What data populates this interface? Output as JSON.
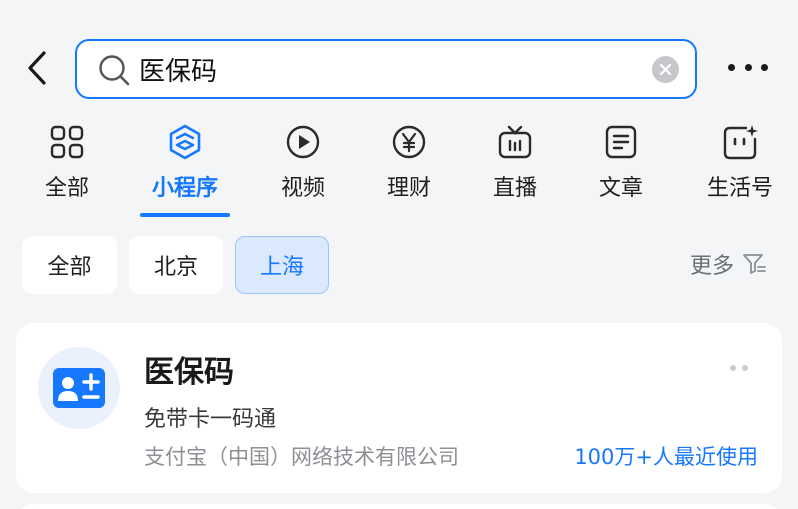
{
  "search": {
    "value": "医保码",
    "back_icon": "chevron-left-icon",
    "clear_icon": "clear-circle-icon",
    "more_icon": "more-horizontal-icon"
  },
  "tabs": [
    {
      "label": "全部",
      "icon": "grid-icon",
      "active": false
    },
    {
      "label": "小程序",
      "icon": "mini-program-icon",
      "active": true
    },
    {
      "label": "视频",
      "icon": "video-play-icon",
      "active": false
    },
    {
      "label": "理财",
      "icon": "yuan-coin-icon",
      "active": false
    },
    {
      "label": "直播",
      "icon": "tv-live-icon",
      "active": false
    },
    {
      "label": "文章",
      "icon": "article-icon",
      "active": false
    },
    {
      "label": "生活号",
      "icon": "life-account-icon",
      "active": false
    }
  ],
  "filters": {
    "chips": [
      {
        "label": "全部",
        "active": false
      },
      {
        "label": "北京",
        "active": false
      },
      {
        "label": "上海",
        "active": true
      }
    ],
    "more_label": "更多"
  },
  "result": {
    "title": "医保码",
    "desc": "免带卡一码通",
    "company": "支付宝（中国）网络技术有限公司",
    "usage": "100万+人最近使用",
    "icon": "medical-card-icon"
  },
  "colors": {
    "accent": "#1677ff",
    "active_chip_bg": "#dbe9ff",
    "page_bg": "#f4f5f7"
  }
}
